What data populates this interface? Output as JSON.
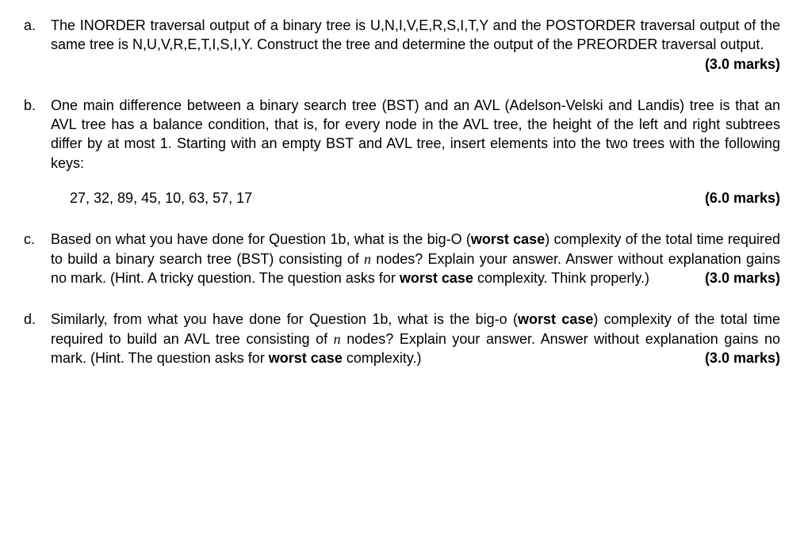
{
  "questions": {
    "a": {
      "label": "a.",
      "text_1": "The INORDER traversal output of a binary tree is U,N,I,V,E,R,S,I,T,Y and the POSTORDER traversal output of the same tree is N,U,V,R,E,T,I,S,I,Y. Construct the tree and determine the output of the PREORDER traversal output.",
      "marks": "(3.0 marks)"
    },
    "b": {
      "label": "b.",
      "text_1": "One main difference between a binary search tree (BST) and an AVL (Adelson-Velski and Landis) tree is that an AVL tree has a balance condition, that is, for every node in the AVL tree, the height of the left and right subtrees differ by at most 1. Starting with an empty BST and AVL tree, insert elements into the two trees with the following keys:",
      "keys": "27, 32, 89, 45, 10, 63, 57, 17",
      "marks": "(6.0 marks)"
    },
    "c": {
      "label": "c.",
      "text_before": "Based on what you have done for Question 1b, what is the big-O (",
      "bold_1": "worst case",
      "text_mid_1": ") complexity of the total time required to build a binary search tree (BST) consisting of ",
      "n": "n",
      "text_mid_2": " nodes? Explain your answer. Answer without explanation gains no mark. (Hint. A tricky question. The question asks for ",
      "bold_2": "worst case",
      "text_after": " complexity. Think properly.)",
      "marks": "(3.0 marks)"
    },
    "d": {
      "label": "d.",
      "text_before": "Similarly, from what you have done for Question 1b, what is the big-o (",
      "bold_1": "worst case",
      "text_mid_1": ") complexity of the total time required to build an AVL tree consisting of ",
      "n": "n",
      "text_mid_2": " nodes? Explain your answer. Answer without explanation gains no mark. (Hint. The question asks for ",
      "bold_2": "worst case",
      "text_after": " complexity.)",
      "marks": "(3.0 marks)"
    }
  }
}
